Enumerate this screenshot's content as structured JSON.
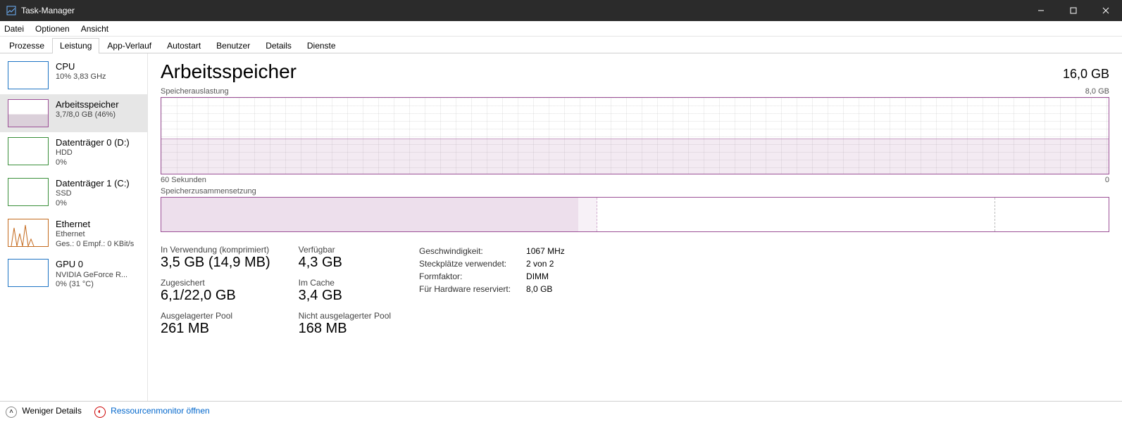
{
  "window": {
    "title": "Task-Manager"
  },
  "menu": [
    "Datei",
    "Optionen",
    "Ansicht"
  ],
  "tabs": [
    "Prozesse",
    "Leistung",
    "App-Verlauf",
    "Autostart",
    "Benutzer",
    "Details",
    "Dienste"
  ],
  "active_tab_index": 1,
  "sidebar": {
    "items": [
      {
        "title": "CPU",
        "sub1": "10% 3,83 GHz",
        "sub2": "",
        "color": "#1e74c4"
      },
      {
        "title": "Arbeitsspeicher",
        "sub1": "3,7/8,0 GB (46%)",
        "sub2": "",
        "color": "#9b4f96",
        "selected": true
      },
      {
        "title": "Datenträger 0 (D:)",
        "sub1": "HDD",
        "sub2": "0%",
        "color": "#3a8f3a"
      },
      {
        "title": "Datenträger 1 (C:)",
        "sub1": "SSD",
        "sub2": "0%",
        "color": "#3a8f3a"
      },
      {
        "title": "Ethernet",
        "sub1": "Ethernet",
        "sub2": "Ges.: 0 Empf.: 0 KBit/s",
        "color": "#c46a1e"
      },
      {
        "title": "GPU 0",
        "sub1": "NVIDIA GeForce R...",
        "sub2": "0% (31 °C)",
        "color": "#1e74c4"
      }
    ]
  },
  "main": {
    "title": "Arbeitsspeicher",
    "total": "16,0 GB",
    "graph1_label": "Speicherauslastung",
    "graph1_max": "8,0 GB",
    "graph1_xaxis_left": "60 Sekunden",
    "graph1_xaxis_right": "0",
    "graph2_label": "Speicherzusammensetzung",
    "composition": {
      "used_pct": 44,
      "modified_pct": 2,
      "standby_pct": 42,
      "free_pct": 12
    },
    "stats": {
      "in_use_label": "In Verwendung (komprimiert)",
      "in_use_value": "3,5 GB (14,9 MB)",
      "available_label": "Verfügbar",
      "available_value": "4,3 GB",
      "committed_label": "Zugesichert",
      "committed_value": "6,1/22,0 GB",
      "cached_label": "Im Cache",
      "cached_value": "3,4 GB",
      "paged_label": "Ausgelagerter Pool",
      "paged_value": "261 MB",
      "nonpaged_label": "Nicht ausgelagerter Pool",
      "nonpaged_value": "168 MB"
    },
    "details": {
      "speed_k": "Geschwindigkeit:",
      "speed_v": "1067 MHz",
      "slots_k": "Steckplätze verwendet:",
      "slots_v": "2 von 2",
      "form_k": "Formfaktor:",
      "form_v": "DIMM",
      "reserved_k": "Für Hardware reserviert:",
      "reserved_v": "8,0 GB"
    }
  },
  "footer": {
    "fewer": "Weniger Details",
    "resmon": "Ressourcenmonitor öffnen"
  },
  "chart_data": {
    "type": "line",
    "title": "Speicherauslastung",
    "xlabel": "60 Sekunden → 0",
    "ylabel": "GB",
    "ylim": [
      0,
      8.0
    ],
    "x_seconds": [
      60,
      55,
      50,
      45,
      40,
      35,
      30,
      25,
      20,
      15,
      10,
      5,
      0
    ],
    "values_gb": [
      3.7,
      3.7,
      3.7,
      3.7,
      3.7,
      3.7,
      3.7,
      3.7,
      3.7,
      3.7,
      3.7,
      3.7,
      3.7
    ],
    "line_color": "#9b4f96",
    "fill_color": "rgba(155,79,150,0.12)"
  }
}
